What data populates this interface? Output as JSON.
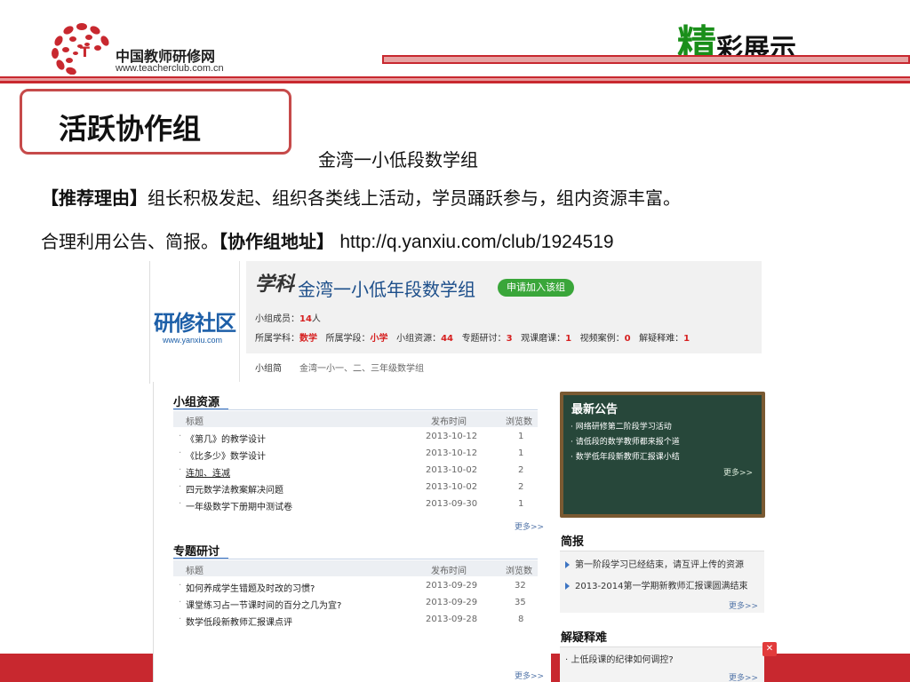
{
  "header": {
    "logo_name": "中国教师研修网",
    "logo_url": "www.teacherclub.com.cn",
    "title_first_char": "精",
    "title_rest": "彩展示"
  },
  "colors": {
    "brand_red": "#c8282f",
    "title_green": "#1a8f1a",
    "link_blue": "#1c4e8a",
    "board_green": "#27473a"
  },
  "slide": {
    "tag": "活跃协作组",
    "group_name": "金湾一小低段数学组",
    "reason_label": "【推荐理由】",
    "reason_text": "组长积极发起、组织各类线上活动，学员踊跃参与，组内资源丰富。",
    "line2_text": "合理利用公告、简报。",
    "address_label": "【协作组地址】",
    "address_url": "http://q.yanxiu.com/club/1924519"
  },
  "screenshot": {
    "site_logo": "研修社区",
    "site_url": "www.yanxiu.com",
    "subject_mark": "学科",
    "group_title": "金湾一小低年段数学组",
    "join_button": "申请加入该组",
    "members_label": "小组成员：",
    "members_count": "14",
    "members_unit": "人",
    "stats": [
      {
        "label": "所属学科：",
        "value": "数学"
      },
      {
        "label": "所属学段：",
        "value": "小学"
      },
      {
        "label": "小组资源：",
        "value": "44"
      },
      {
        "label": "专题研讨：",
        "value": "3"
      },
      {
        "label": "观课磨课：",
        "value": "1"
      },
      {
        "label": "视频案例：",
        "value": "0"
      },
      {
        "label": "解疑释难：",
        "value": "1"
      }
    ],
    "intro_label": "小组简",
    "intro_text": "金湾一小一、二、三年级数学组",
    "resources": {
      "title": "小组资源",
      "col_title": "标题",
      "col_date": "发布时间",
      "col_views": "浏览数",
      "rows": [
        {
          "title": "《第几》的教学设计",
          "date": "2013-10-12",
          "views": "1"
        },
        {
          "title": "《比多少》数学设计",
          "date": "2013-10-12",
          "views": "1"
        },
        {
          "title": "连加、连减",
          "date": "2013-10-02",
          "views": "2"
        },
        {
          "title": "四元数学法教案解决问题",
          "date": "2013-10-02",
          "views": "2"
        },
        {
          "title": "一年级数学下册期中测试卷",
          "date": "2013-09-30",
          "views": "1"
        }
      ],
      "more": "更多>>"
    },
    "topics": {
      "title": "专题研讨",
      "col_title": "标题",
      "col_date": "发布时间",
      "col_views": "浏览数",
      "rows": [
        {
          "title": "如何养成学生错题及时改的习惯?",
          "date": "2013-09-29",
          "views": "32"
        },
        {
          "title": "课堂练习占一节课时间的百分之几为宜?",
          "date": "2013-09-29",
          "views": "35"
        },
        {
          "title": "数学低段新教师汇报课点评",
          "date": "2013-09-28",
          "views": "8"
        }
      ],
      "more": "更多>>"
    },
    "notice": {
      "title": "最新公告",
      "items": [
        "网络研修第二阶段学习活动",
        "请低段的数学教师都来报个道",
        "数学低年段新教师汇报课小结"
      ],
      "more": "更多>>"
    },
    "brief": {
      "title": "简报",
      "items": [
        "第一阶段学习已经结束，请互评上传的资源",
        "2013-2014第一学期新教师汇报课圆满结束"
      ],
      "more": "更多>>"
    },
    "qa": {
      "title": "解疑释难",
      "items": [
        "上低段课的纪律如何调控?"
      ],
      "more": "更多>>"
    }
  }
}
